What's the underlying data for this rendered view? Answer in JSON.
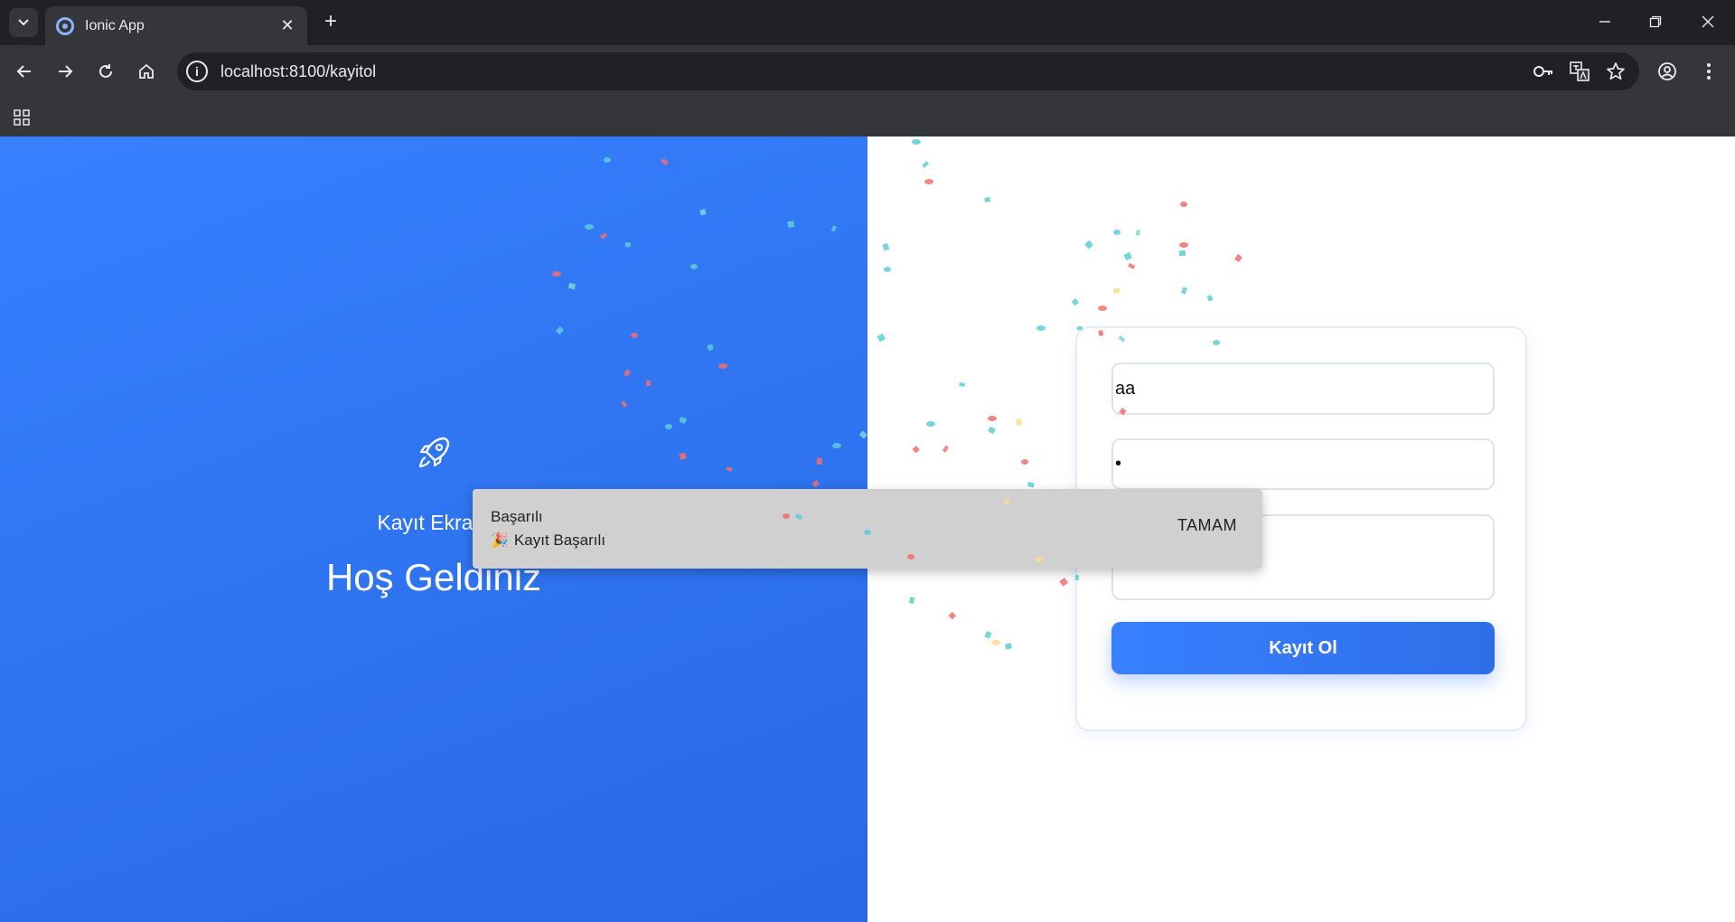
{
  "browser": {
    "tab_title": "Ionic App",
    "tab_close": "✕",
    "new_tab": "+",
    "url": "localhost:8100/kayitol",
    "omni_info": "i"
  },
  "left": {
    "brand_label": "Kayıt Ekranı",
    "welcome": "Hoş Geldiniz"
  },
  "form": {
    "field1_value": "aa",
    "field2_value": "•",
    "field3_value": "",
    "submit_label": "Kayıt Ol"
  },
  "toast": {
    "header": "Başarılı",
    "emoji": "🎉",
    "message": "Kayıt Başarılı",
    "button": "TAMAM"
  },
  "colors": {
    "primary": "#3880ff",
    "confetti": [
      "#5ccfd4",
      "#f26d6d",
      "#ffd98a",
      "#7fd6d9"
    ]
  }
}
